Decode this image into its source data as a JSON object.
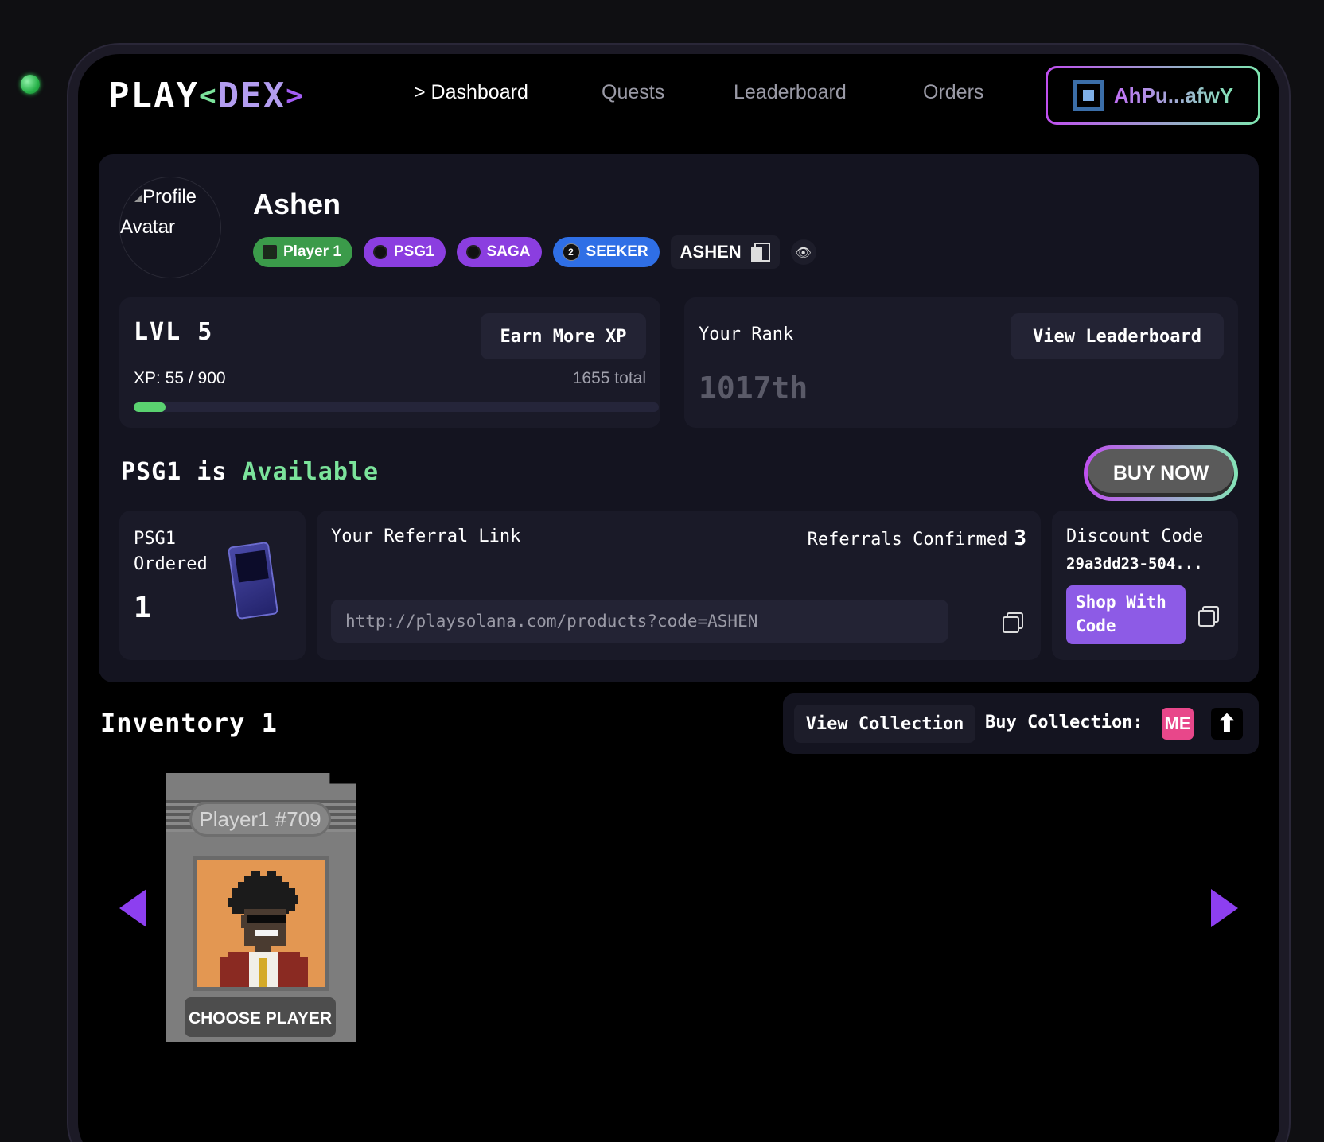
{
  "nav": {
    "logo": {
      "play": "PLAY",
      "open": "<",
      "dex": "DEX",
      "close": ">"
    },
    "links": [
      "> Dashboard",
      "Quests",
      "Leaderboard",
      "Orders"
    ],
    "active_index": 0,
    "wallet": {
      "address": "AhPu...afwY"
    }
  },
  "profile": {
    "avatar_alt": "Profile Avatar",
    "name": "Ashen",
    "badges": [
      {
        "label": "Player 1",
        "color": "#3b9b4a"
      },
      {
        "label": "PSG1",
        "color": "#8b3ee0"
      },
      {
        "label": "SAGA",
        "color": "#8b3ee0"
      },
      {
        "label": "SEEKER",
        "color": "#2f6fe6",
        "icon_text": "2"
      }
    ],
    "referral_tag": "ASHEN"
  },
  "level": {
    "title": "LVL 5",
    "earn_button": "Earn More XP",
    "xp_label": "XP: 55 / 900",
    "xp_current": 55,
    "xp_max": 900,
    "total": "1655 total"
  },
  "rank": {
    "label": "Your Rank",
    "button": "View Leaderboard",
    "value": "1017th"
  },
  "availability": {
    "prefix": "PSG1 is",
    "status": "Available",
    "buy_button": "BUY NOW"
  },
  "ordered": {
    "label": "PSG1 Ordered",
    "count": "1"
  },
  "referral": {
    "label": "Your Referral Link",
    "confirmed_label": "Referrals Confirmed",
    "confirmed_count": "3",
    "link": "http://playsolana.com/products?code=ASHEN"
  },
  "discount": {
    "label": "Discount Code",
    "code": "29a3dd23-504...",
    "shop_button": "Shop With Code"
  },
  "inventory": {
    "title": "Inventory 1",
    "view_collection": "View Collection",
    "buy_collection": "Buy Collection:",
    "marketplaces": [
      {
        "name": "magic-eden",
        "glyph": "ME",
        "color": "#e8478a"
      },
      {
        "name": "tensor",
        "glyph": "⬆"
      }
    ],
    "items": [
      {
        "name": "Player1 #709",
        "action": "CHOOSE PLAYER",
        "bg_color": "#e39752"
      }
    ]
  }
}
